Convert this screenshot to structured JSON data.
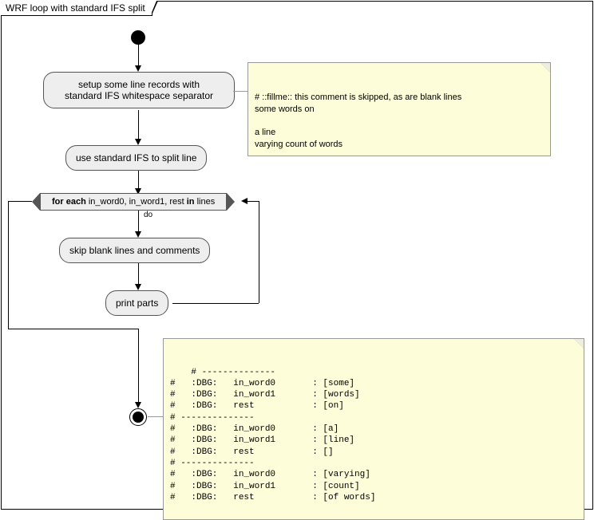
{
  "title": "WRF loop with standard IFS split",
  "nodes": {
    "setup": "setup some line records with\nstandard IFS whitespace separator",
    "use_ifs": "use standard IFS to split line",
    "foreach_pre": "for each",
    "foreach_mid": " in_word0, in_word1, rest ",
    "foreach_in": "in",
    "foreach_post": " lines",
    "do": "do",
    "skip": "skip blank lines and comments",
    "print": "print parts"
  },
  "note1": "# ::fillme:: this comment is skipped, as are blank lines\nsome words on\n\na line\nvarying count of words",
  "note2": "# --------------\n#   :DBG:   in_word0       : [some]\n#   :DBG:   in_word1       : [words]\n#   :DBG:   rest           : [on]\n# --------------\n#   :DBG:   in_word0       : [a]\n#   :DBG:   in_word1       : [line]\n#   :DBG:   rest           : []\n# --------------\n#   :DBG:   in_word0       : [varying]\n#   :DBG:   in_word1       : [count]\n#   :DBG:   rest           : [of words]"
}
